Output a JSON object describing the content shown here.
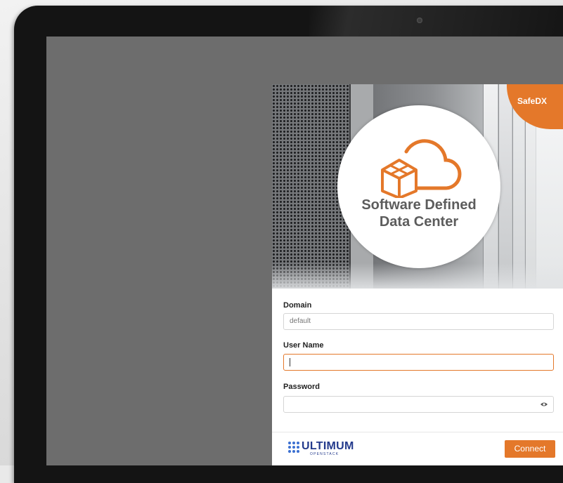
{
  "brand": {
    "badge_text": "SafeDX",
    "accent_color": "#e4782a"
  },
  "hero": {
    "title_line1": "Software Defined",
    "title_line2": "Data Center",
    "icon": "cloud-box-icon"
  },
  "login": {
    "domain_label": "Domain",
    "domain_value": "default",
    "username_label": "User Name",
    "username_value": "",
    "password_label": "Password",
    "password_value": "",
    "password_toggle_icon": "eye-icon",
    "connect_label": "Connect"
  },
  "footer": {
    "logo_text": "ULTIMUM",
    "logo_subtext": "OPENSTACK",
    "logo_text_color": "#233a8c"
  }
}
